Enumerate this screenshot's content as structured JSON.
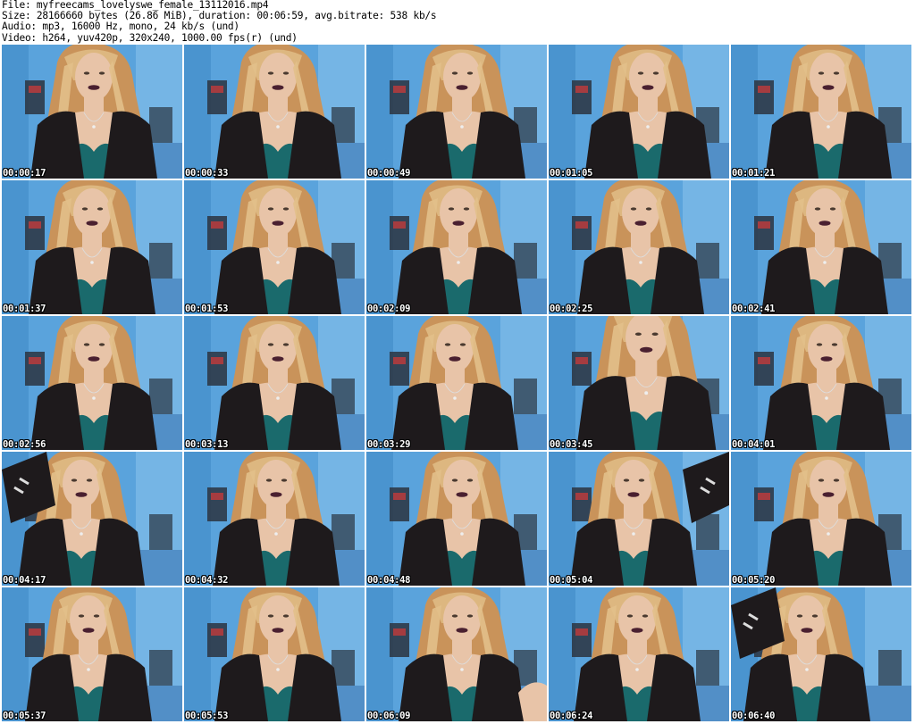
{
  "header": {
    "file_line": "File: myfreecams_lovelyswe_female_13112016.mp4",
    "size_line": "Size: 28166660 bytes (26.86 MiB), duration: 00:06:59, avg.bitrate: 538 kb/s",
    "audio_line": "Audio: mp3, 16000 Hz, mono, 24 kb/s (und)",
    "video_line": "Video: h264, yuv420p, 320x240, 1000.00 fps(r) (und)"
  },
  "thumbnails": [
    {
      "time": "00:00:17",
      "pose": "center"
    },
    {
      "time": "00:00:33",
      "pose": "center"
    },
    {
      "time": "00:00:49",
      "pose": "center"
    },
    {
      "time": "00:01:05",
      "pose": "center"
    },
    {
      "time": "00:01:21",
      "pose": "center"
    },
    {
      "time": "00:01:37",
      "pose": "center"
    },
    {
      "time": "00:01:53",
      "pose": "center"
    },
    {
      "time": "00:02:09",
      "pose": "center"
    },
    {
      "time": "00:02:25",
      "pose": "center"
    },
    {
      "time": "00:02:41",
      "pose": "center"
    },
    {
      "time": "00:02:56",
      "pose": "center"
    },
    {
      "time": "00:03:13",
      "pose": "center"
    },
    {
      "time": "00:03:29",
      "pose": "center"
    },
    {
      "time": "00:03:45",
      "pose": "close"
    },
    {
      "time": "00:04:01",
      "pose": "center"
    },
    {
      "time": "00:04:17",
      "pose": "arm-raised"
    },
    {
      "time": "00:04:32",
      "pose": "center"
    },
    {
      "time": "00:04:48",
      "pose": "center"
    },
    {
      "time": "00:05:04",
      "pose": "arm-raised"
    },
    {
      "time": "00:05:20",
      "pose": "center"
    },
    {
      "time": "00:05:37",
      "pose": "center"
    },
    {
      "time": "00:05:53",
      "pose": "center"
    },
    {
      "time": "00:06:09",
      "pose": "hand"
    },
    {
      "time": "00:06:24",
      "pose": "center"
    },
    {
      "time": "00:06:40",
      "pose": "arm-raised"
    }
  ],
  "colors": {
    "wall": "#5aa3dc",
    "wall_light": "#8cc4ec",
    "hair": "#c9935a",
    "hair_light": "#e2c08a",
    "skin": "#e8c4a8",
    "cardigan": "#1e1a1c",
    "bra": "#1a6a6c",
    "lips": "#4a2030",
    "timestamp_text": "#ffffff"
  }
}
